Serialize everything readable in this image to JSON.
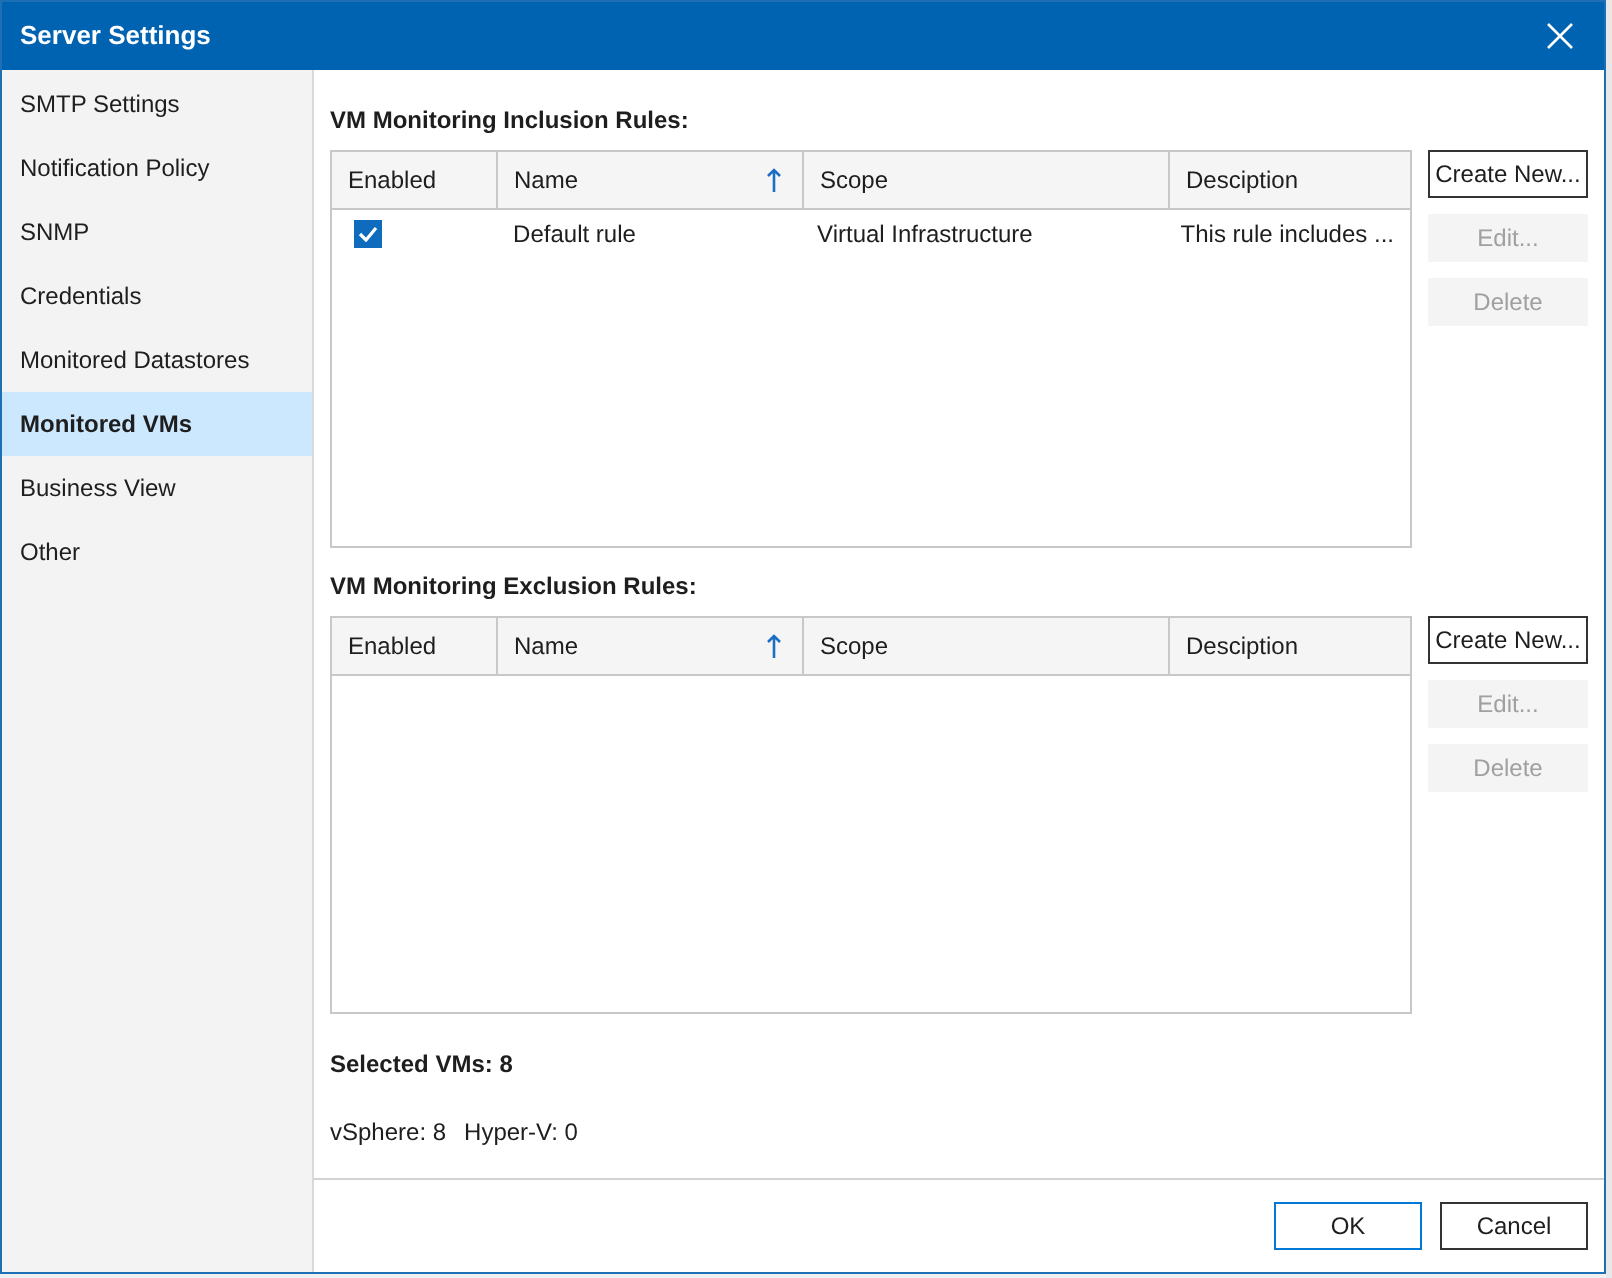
{
  "window": {
    "title": "Server Settings"
  },
  "sidebar": {
    "items": [
      {
        "label": "SMTP Settings",
        "selected": false
      },
      {
        "label": "Notification Policy",
        "selected": false
      },
      {
        "label": "SNMP",
        "selected": false
      },
      {
        "label": "Credentials",
        "selected": false
      },
      {
        "label": "Monitored Datastores",
        "selected": false
      },
      {
        "label": "Monitored VMs",
        "selected": true
      },
      {
        "label": "Business View",
        "selected": false
      },
      {
        "label": "Other",
        "selected": false
      }
    ]
  },
  "sections": [
    {
      "title": "VM Monitoring Inclusion Rules:",
      "columns": [
        "Enabled",
        "Name",
        "Scope",
        "Desciption"
      ],
      "rows": [
        {
          "checked": true,
          "name": "Default rule",
          "scope": "Virtual Infrastructure",
          "description": "This rule includes ..."
        }
      ],
      "buttons": [
        {
          "label": "Create New...",
          "disabled": false
        },
        {
          "label": "Edit...",
          "disabled": true
        },
        {
          "label": "Delete",
          "disabled": true
        }
      ]
    },
    {
      "title": "VM Monitoring Exclusion Rules:",
      "columns": [
        "Enabled",
        "Name",
        "Scope",
        "Desciption"
      ],
      "buttons": [
        {
          "label": "Create New...",
          "disabled": false
        },
        {
          "label": "Edit...",
          "disabled": true
        },
        {
          "label": "Delete",
          "disabled": true
        }
      ]
    }
  ],
  "summary": {
    "title": "Selected VMs: 8",
    "vsphere": "vSphere: 8",
    "hyperv": "Hyper-V: 0"
  },
  "footer_buttons": [
    {
      "label": "OK",
      "kind": "default"
    },
    {
      "label": "Cancel",
      "kind": "normal"
    }
  ]
}
